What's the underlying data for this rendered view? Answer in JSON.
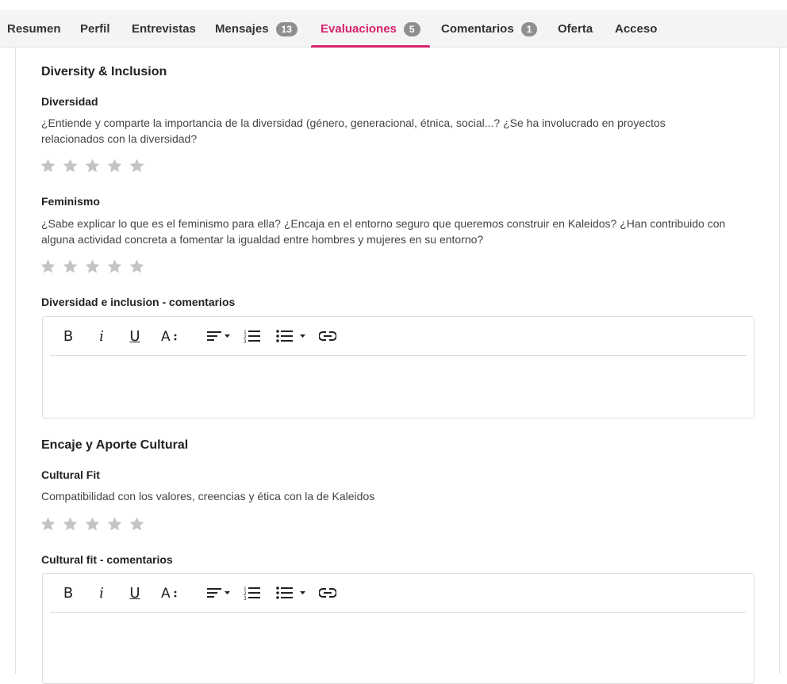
{
  "tabs": [
    {
      "label": "Resumen"
    },
    {
      "label": "Perfil"
    },
    {
      "label": "Entrevistas"
    },
    {
      "label": "Mensajes",
      "badge": "13"
    },
    {
      "label": "Evaluaciones",
      "badge": "5",
      "active": true
    },
    {
      "label": "Comentarios",
      "badge": "1"
    },
    {
      "label": "Oferta"
    },
    {
      "label": "Acceso"
    }
  ],
  "sections": {
    "diversity": {
      "title": "Diversity & Inclusion",
      "q1": {
        "title": "Diversidad",
        "line1": "¿Entiende y comparte la importancia de la diversidad (género, generacional, étnica, social...? ¿Se ha involucrado en proyectos",
        "line2": "relacionados con la diversidad?",
        "rating": 0
      },
      "q2": {
        "title": "Feminismo",
        "line1": "¿Sabe explicar lo que es el feminismo para ella? ¿Encaja en el entorno seguro que queremos construir en Kaleidos? ¿Han contribuido con",
        "line2": "alguna actividad concreta a fomentar la igualdad entre hombres y mujeres en su entorno?",
        "rating": 0
      },
      "comments_label": "Diversidad e inclusion - comentarios"
    },
    "culture": {
      "title": "Encaje y Aporte Cultural",
      "q1": {
        "title": "Cultural Fit",
        "line1": "Compatibilidad con los valores, creencias y ética con la de Kaleidos",
        "rating": 0
      },
      "comments_label": "Cultural fit - comentarios"
    }
  },
  "toolbar_icons": [
    "bold-icon",
    "italic-icon",
    "underline-icon",
    "font-size-icon",
    "align-icon",
    "ordered-list-icon",
    "unordered-list-icon",
    "link-icon"
  ],
  "colors": {
    "accent": "#d6246e",
    "badge": "#8f8f8f",
    "star": "#c4c4c4"
  },
  "max_stars": 5
}
